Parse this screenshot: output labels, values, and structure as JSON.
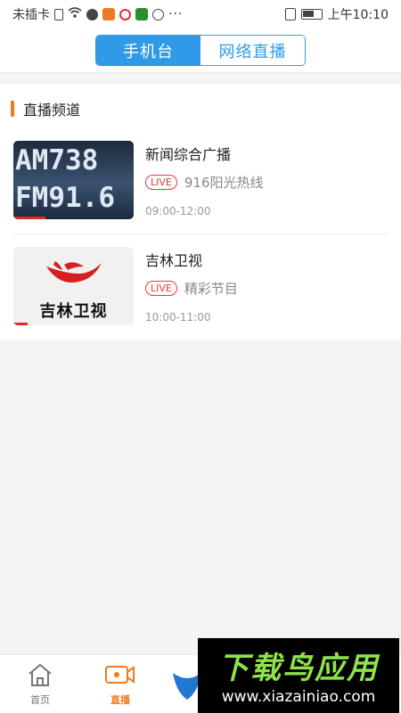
{
  "status_bar": {
    "carrier": "未插卡",
    "more": "···",
    "time": "上午10:10"
  },
  "tabs": [
    {
      "label": "手机台",
      "active": true
    },
    {
      "label": "网络直播",
      "active": false
    }
  ],
  "section": {
    "title": "直播频道"
  },
  "channels": [
    {
      "title": "新闻综合广播",
      "live_badge": "LIVE",
      "program": "916阳光热线",
      "time": "09:00-12:00",
      "thumb_line1": "AM738",
      "thumb_line2": "FM91.6",
      "progress": 0.27
    },
    {
      "title": "吉林卫视",
      "live_badge": "LIVE",
      "program": "精彩节目",
      "time": "10:00-11:00",
      "thumb_text": "吉林卫视",
      "progress": 0.12
    }
  ],
  "bottom_nav": [
    {
      "label": "首页",
      "icon": "home-icon"
    },
    {
      "label": "直播",
      "icon": "video-camera-icon",
      "active": true
    }
  ],
  "watermark": {
    "title": "下载鸟应用",
    "url": "www.xiazainiao.com"
  },
  "colors": {
    "accent_blue": "#2f9ae8",
    "accent_orange": "#f07a22",
    "live_red": "#e83a3a"
  }
}
